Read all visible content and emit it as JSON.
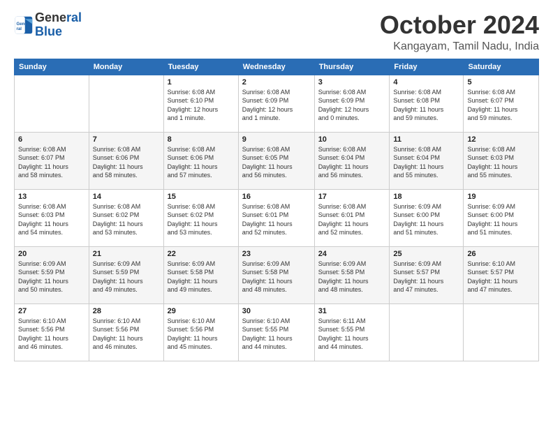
{
  "logo": {
    "line1": "General",
    "line2": "Blue"
  },
  "title": "October 2024",
  "subtitle": "Kangayam, Tamil Nadu, India",
  "days_header": [
    "Sunday",
    "Monday",
    "Tuesday",
    "Wednesday",
    "Thursday",
    "Friday",
    "Saturday"
  ],
  "weeks": [
    [
      {
        "day": "",
        "info": ""
      },
      {
        "day": "",
        "info": ""
      },
      {
        "day": "1",
        "info": "Sunrise: 6:08 AM\nSunset: 6:10 PM\nDaylight: 12 hours\nand 1 minute."
      },
      {
        "day": "2",
        "info": "Sunrise: 6:08 AM\nSunset: 6:09 PM\nDaylight: 12 hours\nand 1 minute."
      },
      {
        "day": "3",
        "info": "Sunrise: 6:08 AM\nSunset: 6:09 PM\nDaylight: 12 hours\nand 0 minutes."
      },
      {
        "day": "4",
        "info": "Sunrise: 6:08 AM\nSunset: 6:08 PM\nDaylight: 11 hours\nand 59 minutes."
      },
      {
        "day": "5",
        "info": "Sunrise: 6:08 AM\nSunset: 6:07 PM\nDaylight: 11 hours\nand 59 minutes."
      }
    ],
    [
      {
        "day": "6",
        "info": "Sunrise: 6:08 AM\nSunset: 6:07 PM\nDaylight: 11 hours\nand 58 minutes."
      },
      {
        "day": "7",
        "info": "Sunrise: 6:08 AM\nSunset: 6:06 PM\nDaylight: 11 hours\nand 58 minutes."
      },
      {
        "day": "8",
        "info": "Sunrise: 6:08 AM\nSunset: 6:06 PM\nDaylight: 11 hours\nand 57 minutes."
      },
      {
        "day": "9",
        "info": "Sunrise: 6:08 AM\nSunset: 6:05 PM\nDaylight: 11 hours\nand 56 minutes."
      },
      {
        "day": "10",
        "info": "Sunrise: 6:08 AM\nSunset: 6:04 PM\nDaylight: 11 hours\nand 56 minutes."
      },
      {
        "day": "11",
        "info": "Sunrise: 6:08 AM\nSunset: 6:04 PM\nDaylight: 11 hours\nand 55 minutes."
      },
      {
        "day": "12",
        "info": "Sunrise: 6:08 AM\nSunset: 6:03 PM\nDaylight: 11 hours\nand 55 minutes."
      }
    ],
    [
      {
        "day": "13",
        "info": "Sunrise: 6:08 AM\nSunset: 6:03 PM\nDaylight: 11 hours\nand 54 minutes."
      },
      {
        "day": "14",
        "info": "Sunrise: 6:08 AM\nSunset: 6:02 PM\nDaylight: 11 hours\nand 53 minutes."
      },
      {
        "day": "15",
        "info": "Sunrise: 6:08 AM\nSunset: 6:02 PM\nDaylight: 11 hours\nand 53 minutes."
      },
      {
        "day": "16",
        "info": "Sunrise: 6:08 AM\nSunset: 6:01 PM\nDaylight: 11 hours\nand 52 minutes."
      },
      {
        "day": "17",
        "info": "Sunrise: 6:08 AM\nSunset: 6:01 PM\nDaylight: 11 hours\nand 52 minutes."
      },
      {
        "day": "18",
        "info": "Sunrise: 6:09 AM\nSunset: 6:00 PM\nDaylight: 11 hours\nand 51 minutes."
      },
      {
        "day": "19",
        "info": "Sunrise: 6:09 AM\nSunset: 6:00 PM\nDaylight: 11 hours\nand 51 minutes."
      }
    ],
    [
      {
        "day": "20",
        "info": "Sunrise: 6:09 AM\nSunset: 5:59 PM\nDaylight: 11 hours\nand 50 minutes."
      },
      {
        "day": "21",
        "info": "Sunrise: 6:09 AM\nSunset: 5:59 PM\nDaylight: 11 hours\nand 49 minutes."
      },
      {
        "day": "22",
        "info": "Sunrise: 6:09 AM\nSunset: 5:58 PM\nDaylight: 11 hours\nand 49 minutes."
      },
      {
        "day": "23",
        "info": "Sunrise: 6:09 AM\nSunset: 5:58 PM\nDaylight: 11 hours\nand 48 minutes."
      },
      {
        "day": "24",
        "info": "Sunrise: 6:09 AM\nSunset: 5:58 PM\nDaylight: 11 hours\nand 48 minutes."
      },
      {
        "day": "25",
        "info": "Sunrise: 6:09 AM\nSunset: 5:57 PM\nDaylight: 11 hours\nand 47 minutes."
      },
      {
        "day": "26",
        "info": "Sunrise: 6:10 AM\nSunset: 5:57 PM\nDaylight: 11 hours\nand 47 minutes."
      }
    ],
    [
      {
        "day": "27",
        "info": "Sunrise: 6:10 AM\nSunset: 5:56 PM\nDaylight: 11 hours\nand 46 minutes."
      },
      {
        "day": "28",
        "info": "Sunrise: 6:10 AM\nSunset: 5:56 PM\nDaylight: 11 hours\nand 46 minutes."
      },
      {
        "day": "29",
        "info": "Sunrise: 6:10 AM\nSunset: 5:56 PM\nDaylight: 11 hours\nand 45 minutes."
      },
      {
        "day": "30",
        "info": "Sunrise: 6:10 AM\nSunset: 5:55 PM\nDaylight: 11 hours\nand 44 minutes."
      },
      {
        "day": "31",
        "info": "Sunrise: 6:11 AM\nSunset: 5:55 PM\nDaylight: 11 hours\nand 44 minutes."
      },
      {
        "day": "",
        "info": ""
      },
      {
        "day": "",
        "info": ""
      }
    ]
  ]
}
